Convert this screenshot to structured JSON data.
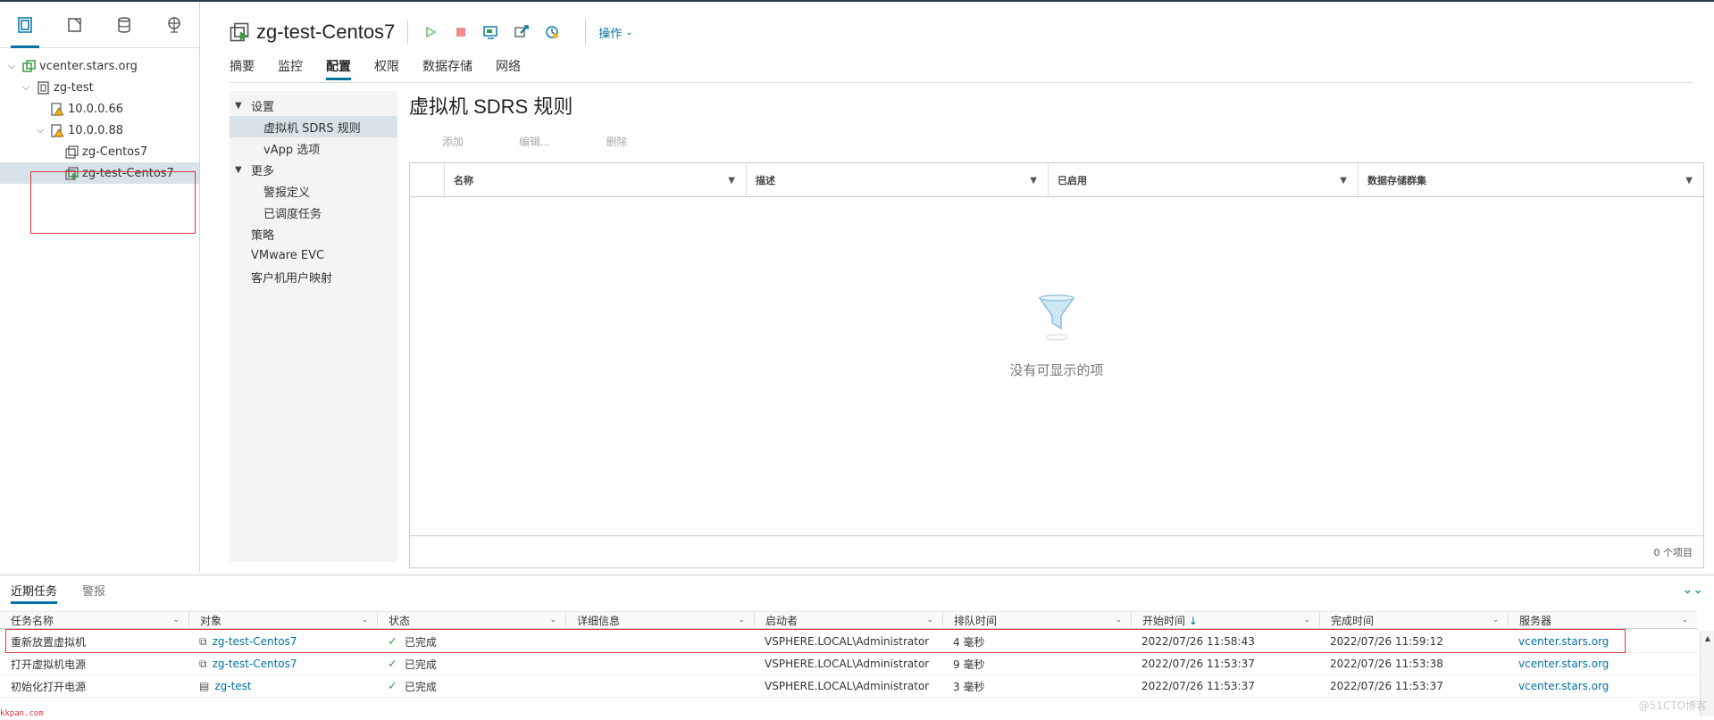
{
  "nav": {
    "tabs": [
      "hosts-clusters-icon",
      "vms-templates-icon",
      "storage-icon",
      "networking-icon"
    ],
    "tree": [
      {
        "label": "vcenter.stars.org",
        "level": 0,
        "icon": "vcenter-icon"
      },
      {
        "label": "zg-test",
        "level": 1,
        "icon": "datacenter-icon"
      },
      {
        "label": "10.0.0.66",
        "level": 2,
        "icon": "host-warning-icon"
      },
      {
        "label": "10.0.0.88",
        "level": 2,
        "icon": "host-warning-icon"
      },
      {
        "label": "zg-Centos7",
        "level": 3,
        "icon": "vm-icon"
      },
      {
        "label": "zg-test-Centos7",
        "level": 3,
        "icon": "vm-running-icon"
      }
    ]
  },
  "header": {
    "title": "zg-test-Centos7",
    "actions_label": "操作"
  },
  "tabs": [
    "摘要",
    "监控",
    "配置",
    "权限",
    "数据存储",
    "网络"
  ],
  "active_tab": "配置",
  "config": {
    "settings": "设置",
    "sdrs": "虚拟机 SDRS 规则",
    "vapp": "vApp 选项",
    "more": "更多",
    "alarm": "警报定义",
    "scheduled": "已调度任务",
    "policy": "策略",
    "evc": "VMware EVC",
    "guest": "客户机用户映射"
  },
  "content": {
    "title": "虚拟机 SDRS 规则",
    "add": "添加",
    "edit": "编辑...",
    "delete": "删除",
    "columns": [
      "名称",
      "描述",
      "已启用",
      "数据存储群集"
    ],
    "empty": "没有可显示的项",
    "count": "0 个项目"
  },
  "tasks": {
    "tab_recent": "近期任务",
    "tab_alarms": "警报",
    "columns": [
      "任务名称",
      "对象",
      "状态",
      "详细信息",
      "启动者",
      "排队时间",
      "开始时间",
      "完成时间",
      "服务器"
    ],
    "sort_indicator": "↓",
    "rows": [
      {
        "name": "重新放置虚拟机",
        "object": "zg-test-Centos7",
        "status": "已完成",
        "details": "",
        "initiator": "VSPHERE.LOCAL\\Administrator",
        "queued": "4 毫秒",
        "start": "2022/07/26 11:58:43",
        "end": "2022/07/26 11:59:12",
        "server": "vcenter.stars.org"
      },
      {
        "name": "打开虚拟机电源",
        "object": "zg-test-Centos7",
        "status": "已完成",
        "details": "",
        "initiator": "VSPHERE.LOCAL\\Administrator",
        "queued": "9 毫秒",
        "start": "2022/07/26 11:53:37",
        "end": "2022/07/26 11:53:38",
        "server": "vcenter.stars.org"
      },
      {
        "name": "初始化打开电源",
        "object": "zg-test",
        "status": "已完成",
        "details": "",
        "initiator": "VSPHERE.LOCAL\\Administrator",
        "queued": "3 毫秒",
        "start": "2022/07/26 11:53:37",
        "end": "2022/07/26 11:53:37",
        "server": "vcenter.stars.org"
      }
    ]
  },
  "watermark": "kkpan.com",
  "watermark2": "@51CTO博客",
  "colors": {
    "accent": "#0072a3",
    "highlight_box": "#d9363e",
    "success": "#3a9b46"
  }
}
